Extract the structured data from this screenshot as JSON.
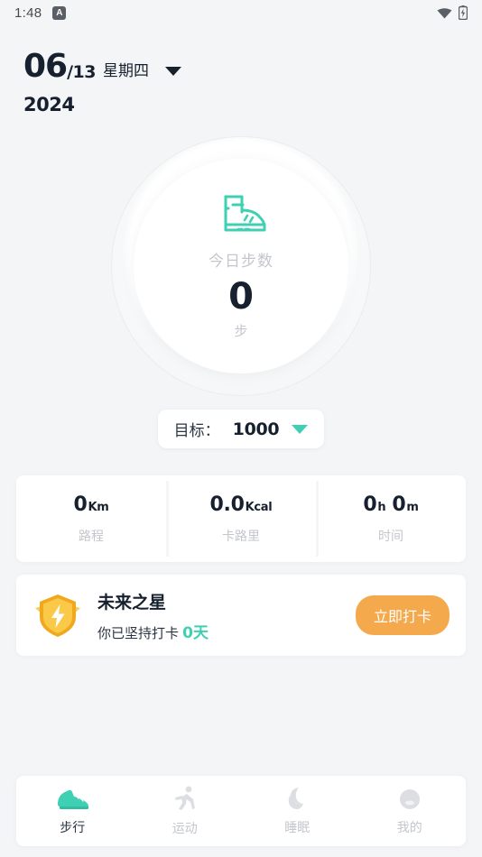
{
  "statusbar": {
    "time": "1:48",
    "app_icon_letter": "A",
    "wifi_icon": "wifi-icon",
    "battery_icon": "battery-charging-icon"
  },
  "header": {
    "month": "06",
    "day": "/13",
    "weekday": "星期四",
    "year": "2024",
    "caret_icon": "chevron-down-icon"
  },
  "ring": {
    "icon": "boot-icon",
    "label": "今日步数",
    "value": "0",
    "unit": "步"
  },
  "goal": {
    "label": "目标：",
    "value": "1000",
    "caret_icon": "chevron-down-icon"
  },
  "stats": [
    {
      "value": "0",
      "unit": "Km",
      "name": "路程"
    },
    {
      "value": "0.0",
      "unit": "Kcal",
      "name": "卡路里"
    },
    {
      "value": "0",
      "unit": "h",
      "value2": "0",
      "unit2": "m",
      "name": "时间"
    }
  ],
  "achievement": {
    "badge_icon": "shield-lightning-badge-icon",
    "title": "未来之星",
    "subtitle_prefix": "你已坚持打卡 ",
    "days": "0天",
    "button_label": "立即打卡"
  },
  "bottom_nav": [
    {
      "label": "步行",
      "icon": "sneaker-icon",
      "active": true
    },
    {
      "label": "运动",
      "icon": "running-person-icon",
      "active": false
    },
    {
      "label": "睡眠",
      "icon": "moon-icon",
      "active": false
    },
    {
      "label": "我的",
      "icon": "user-avatar-icon",
      "active": false
    }
  ],
  "colors": {
    "accent_teal": "#3fd0b4",
    "accent_orange": "#f5a94d",
    "text_dark": "#16202e",
    "text_muted": "#c3c6cc",
    "background": "#f4f5f7"
  }
}
